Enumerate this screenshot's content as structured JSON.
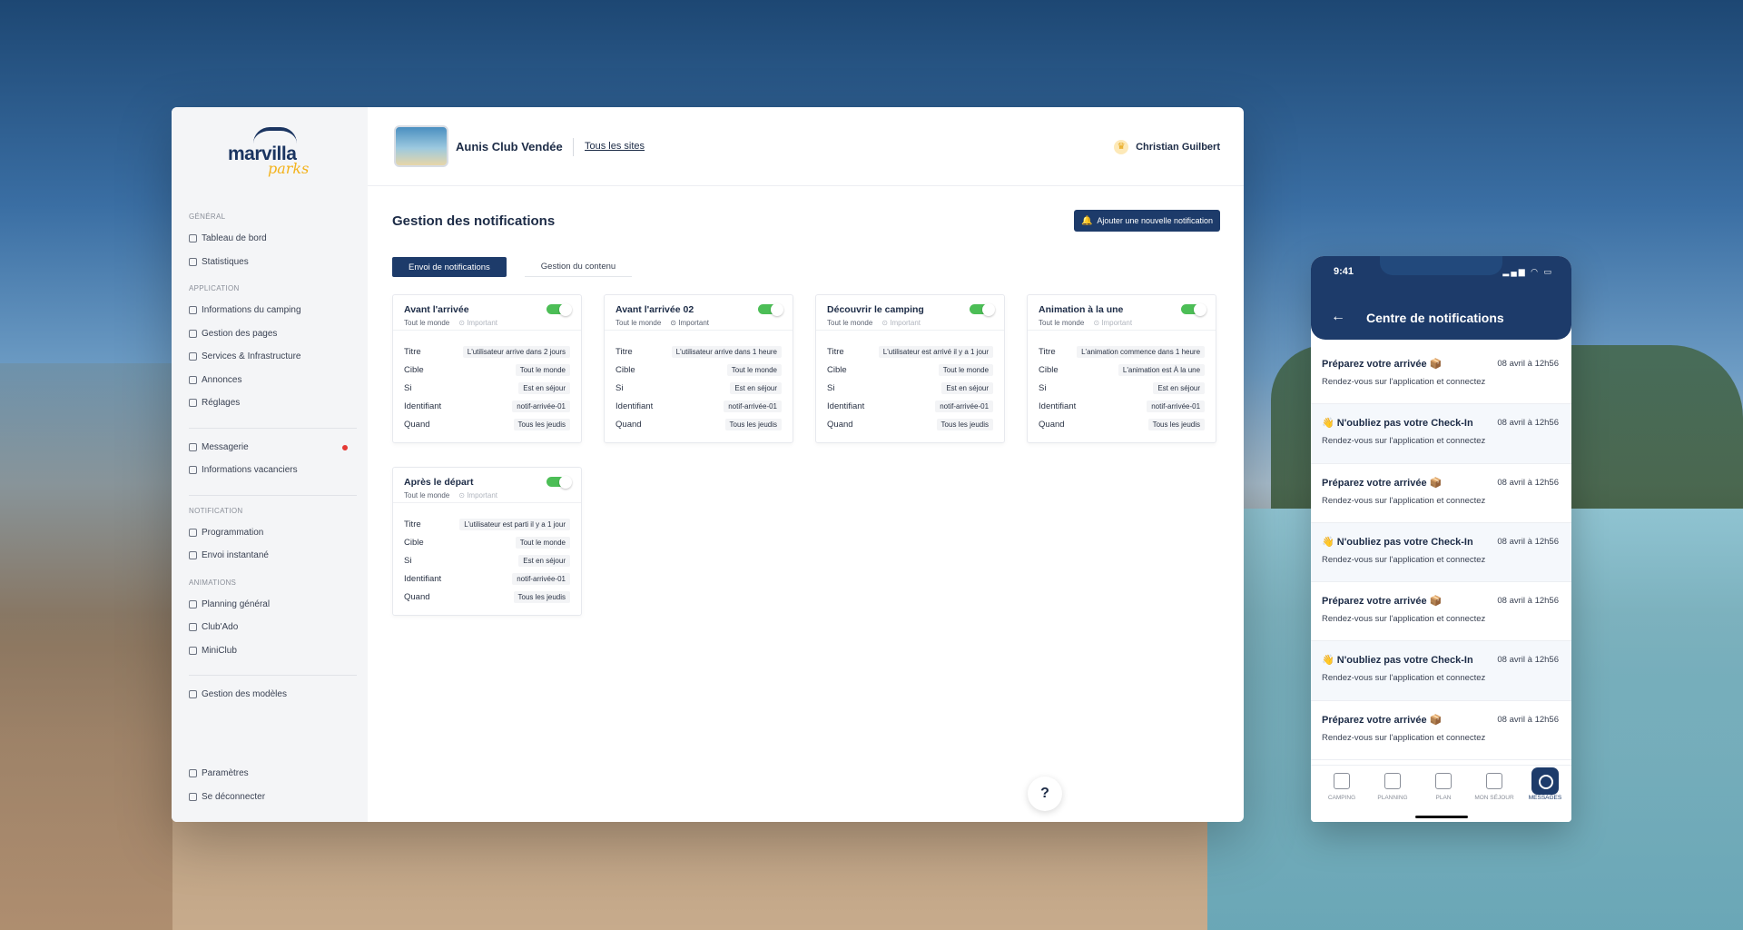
{
  "sidebar": {
    "logo_main": "marvilla",
    "logo_sub": "parks",
    "sections": [
      {
        "title": "Général",
        "items": [
          "Tableau de bord",
          "Statistiques"
        ]
      },
      {
        "title": "Application",
        "items": [
          "Informations du camping",
          "Gestion des pages",
          "Services & Infrastructure",
          "Annonces",
          "Réglages"
        ]
      },
      {
        "title": "",
        "items": [
          "Messagerie",
          "Informations vacanciers"
        ]
      },
      {
        "title": "Notification",
        "items": [
          "Programmation",
          "Envoi instantané"
        ]
      },
      {
        "title": "Animations",
        "items": [
          "Planning général",
          "Club'Ado",
          "MiniClub"
        ]
      },
      {
        "title": "",
        "items": [
          "Gestion des modèles"
        ]
      }
    ],
    "bottom_items": [
      "Paramètres",
      "Se déconnecter"
    ]
  },
  "topbar": {
    "site_name": "Aunis Club Vendée",
    "all_sites": "Tous les sites",
    "user_name": "Christian Guilbert"
  },
  "page": {
    "title": "Gestion des notifications",
    "add_button": "Ajouter une nouvelle notification",
    "tabs": [
      "Envoi de notifications",
      "Gestion du contenu"
    ]
  },
  "cards": [
    {
      "title": "Avant l'arrivée",
      "audience": "Tout le monde",
      "important": "Important",
      "enabled": true,
      "rows": [
        [
          "Titre",
          "L'utilisateur arrive dans 2 jours"
        ],
        [
          "Cible",
          "Tout le monde"
        ],
        [
          "Si",
          "Est en séjour"
        ],
        [
          "Identifiant",
          "notif-arrivée-01"
        ],
        [
          "Quand",
          "Tous les jeudis"
        ]
      ]
    },
    {
      "title": "Avant l'arrivée 02",
      "audience": "Tout le monde",
      "important": "Important",
      "enabled": true,
      "rows": [
        [
          "Titre",
          "L'utilisateur arrive dans 1 heure"
        ],
        [
          "Cible",
          "Tout le monde"
        ],
        [
          "Si",
          "Est en séjour"
        ],
        [
          "Identifiant",
          "notif-arrivée-01"
        ],
        [
          "Quand",
          "Tous les jeudis"
        ]
      ]
    },
    {
      "title": "Découvrir le camping",
      "audience": "Tout le monde",
      "important": "Important",
      "enabled": true,
      "rows": [
        [
          "Titre",
          "L'utilisateur est arrivé il y a 1 jour"
        ],
        [
          "Cible",
          "Tout le monde"
        ],
        [
          "Si",
          "Est en séjour"
        ],
        [
          "Identifiant",
          "notif-arrivée-01"
        ],
        [
          "Quand",
          "Tous les jeudis"
        ]
      ]
    },
    {
      "title": "Animation à la une",
      "audience": "Tout le monde",
      "important": "Important",
      "enabled": true,
      "rows": [
        [
          "Titre",
          "L'animation commence dans 1 heure"
        ],
        [
          "Cible",
          "L'animation est À la une"
        ],
        [
          "Si",
          "Est en séjour"
        ],
        [
          "Identifiant",
          "notif-arrivée-01"
        ],
        [
          "Quand",
          "Tous les jeudis"
        ]
      ]
    },
    {
      "title": "Après le départ",
      "audience": "Tout le monde",
      "important": "Important",
      "enabled": true,
      "rows": [
        [
          "Titre",
          "L'utilisateur est parti il y a 1 jour"
        ],
        [
          "Cible",
          "Tout le monde"
        ],
        [
          "Si",
          "Est en séjour"
        ],
        [
          "Identifiant",
          "notif-arrivée-01"
        ],
        [
          "Quand",
          "Tous les jeudis"
        ]
      ]
    }
  ],
  "help": "?",
  "phone": {
    "time": "9:41",
    "title": "Centre de notifications",
    "notifications": [
      {
        "title": "Préparez votre arrivée 📦",
        "date": "08 avril à 12h56",
        "message": "Rendez-vous sur l'application et connectez"
      },
      {
        "title": "👋 N'oubliez pas votre Check-In",
        "date": "08 avril à 12h56",
        "message": "Rendez-vous sur l'application et connectez"
      },
      {
        "title": "Préparez votre arrivée 📦",
        "date": "08 avril à 12h56",
        "message": "Rendez-vous sur l'application et connectez"
      },
      {
        "title": "👋 N'oubliez pas votre Check-In",
        "date": "08 avril à 12h56",
        "message": "Rendez-vous sur l'application et connectez"
      },
      {
        "title": "Préparez votre arrivée 📦",
        "date": "08 avril à 12h56",
        "message": "Rendez-vous sur l'application et connectez"
      },
      {
        "title": "👋 N'oubliez pas votre Check-In",
        "date": "08 avril à 12h56",
        "message": "Rendez-vous sur l'application et connectez"
      },
      {
        "title": "Préparez votre arrivée 📦",
        "date": "08 avril à 12h56",
        "message": "Rendez-vous sur l'application et connectez"
      }
    ],
    "tabs": [
      "Camping",
      "Planning",
      "Plan",
      "Mon séjour",
      "Messages"
    ],
    "active_tab": 4
  },
  "colors": {
    "primary": "#1d3b6a",
    "toggle_on": "#4cbe56",
    "badge": "#e53935"
  }
}
